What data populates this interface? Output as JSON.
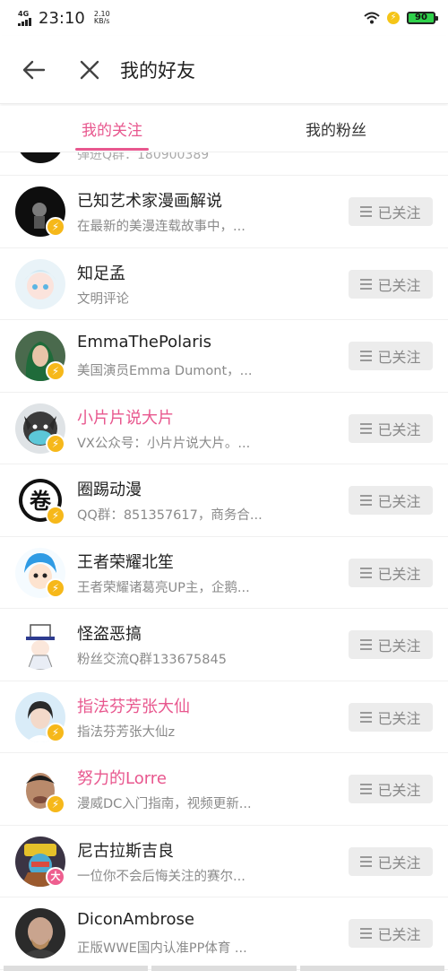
{
  "status_bar": {
    "network": "4G",
    "time": "23:10",
    "speed_value": "2.10",
    "speed_unit": "KB/s",
    "battery": "90"
  },
  "header": {
    "title": "我的好友"
  },
  "tabs": [
    {
      "label": "我的关注",
      "active": true
    },
    {
      "label": "我的粉丝",
      "active": false
    }
  ],
  "partial_row": {
    "desc": "弹进Q群：180900389"
  },
  "follow_label": "已关注",
  "users": [
    {
      "name": "已知艺术家漫画解说",
      "desc": "在最新的美漫连载故事中，...",
      "badge": "⚡",
      "name_color": "default"
    },
    {
      "name": "知足孟",
      "desc": "文明评论",
      "badge": "",
      "name_color": "default"
    },
    {
      "name": "EmmaThePolaris",
      "desc": "美国演员Emma Dumont，...",
      "badge": "⚡",
      "name_color": "default"
    },
    {
      "name": "小片片说大片",
      "desc": "VX公众号：小片片说大片。...",
      "badge": "⚡",
      "name_color": "pink"
    },
    {
      "name": "圈踢动漫",
      "desc": "QQ群：851357617，商务合...",
      "badge": "⚡",
      "name_color": "default"
    },
    {
      "name": "王者荣耀北笙",
      "desc": "王者荣耀诸葛亮UP主，企鹅...",
      "badge": "⚡",
      "name_color": "default"
    },
    {
      "name": "怪盗恶搞",
      "desc": "粉丝交流Q群133675845",
      "badge": "",
      "name_color": "default"
    },
    {
      "name": "指法芬芳张大仙",
      "desc": "指法芬芳张大仙z",
      "badge": "⚡",
      "name_color": "pink"
    },
    {
      "name": "努力的Lorre",
      "desc": "漫威DC入门指南，视频更新...",
      "badge": "⚡",
      "name_color": "pink"
    },
    {
      "name": "尼古拉斯吉良",
      "desc": "一位你不会后悔关注的赛尔...",
      "badge": "大",
      "name_color": "default"
    },
    {
      "name": "DiconAmbrose",
      "desc": "正版WWE国内认准PP体育 ...",
      "badge": "",
      "name_color": "default"
    }
  ],
  "colors": {
    "accent": "#e8578e",
    "badge_yellow": "#f6b81a",
    "badge_pink": "#ee5e8f"
  }
}
